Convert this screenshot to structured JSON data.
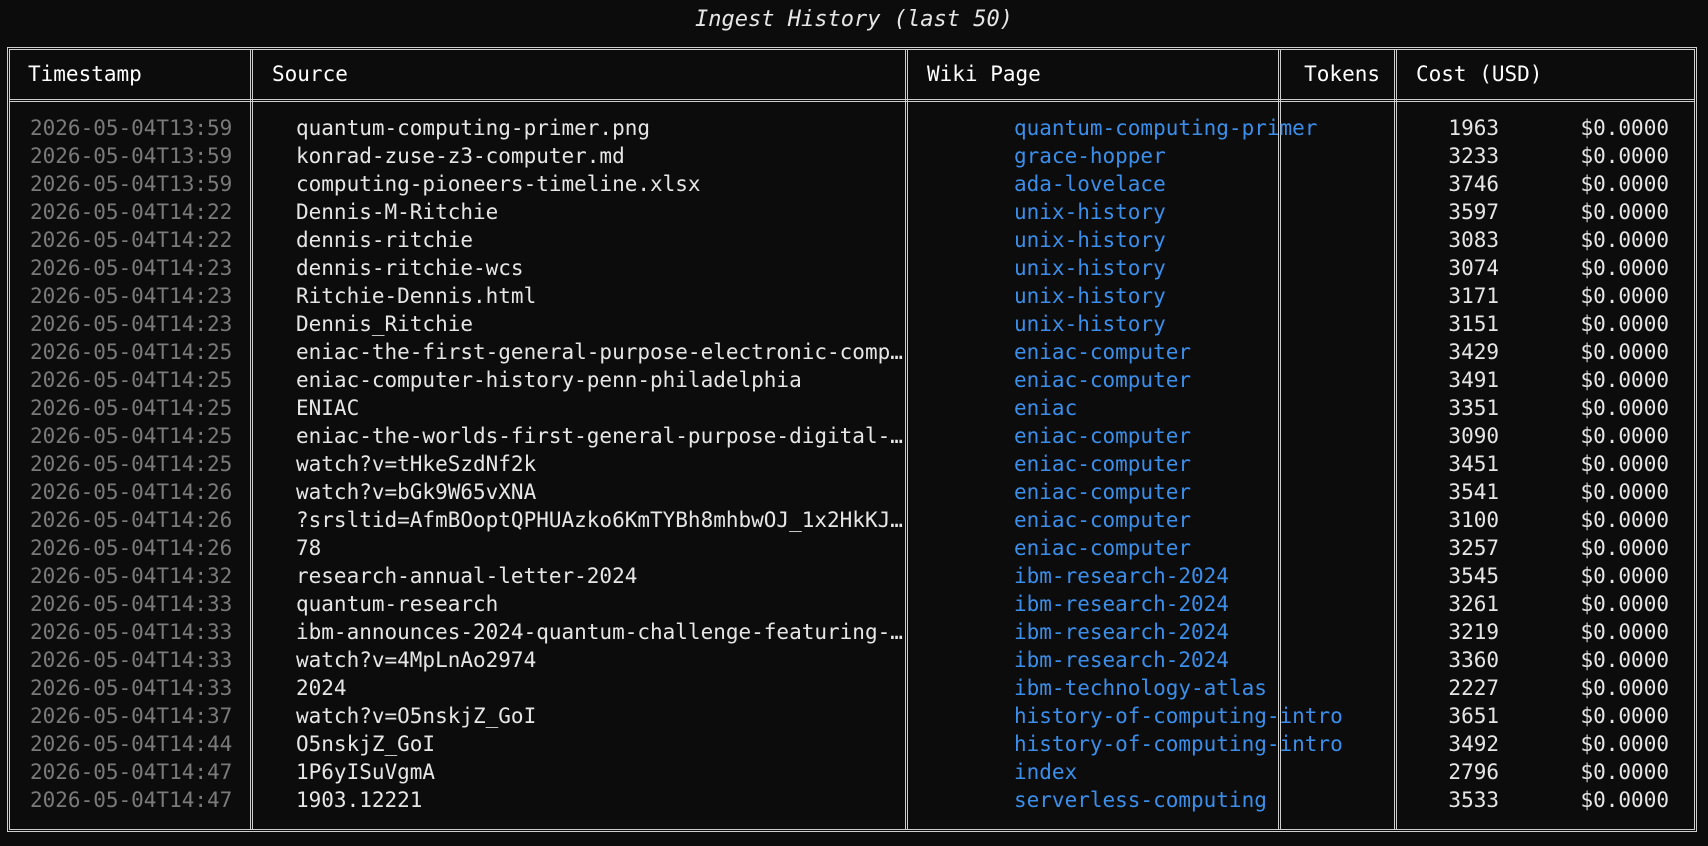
{
  "title": "Ingest History (last 50)",
  "columns": {
    "timestamp": "Timestamp",
    "source": "Source",
    "wiki_page": "Wiki Page",
    "tokens": "Tokens",
    "cost": "Cost (USD)"
  },
  "colors": {
    "background": "#0c0c0c",
    "border": "#cfcfcf",
    "timestamp_text": "#7a7a7a",
    "link_text": "#3b8eea",
    "body_text": "#e6e6e6"
  },
  "rows": [
    {
      "timestamp": "2026-05-04T13:59",
      "source": "quantum-computing-primer.png",
      "wiki_page": "quantum-computing-primer",
      "tokens": "1963",
      "cost": "$0.0000"
    },
    {
      "timestamp": "2026-05-04T13:59",
      "source": "konrad-zuse-z3-computer.md",
      "wiki_page": "grace-hopper",
      "tokens": "3233",
      "cost": "$0.0000"
    },
    {
      "timestamp": "2026-05-04T13:59",
      "source": "computing-pioneers-timeline.xlsx",
      "wiki_page": "ada-lovelace",
      "tokens": "3746",
      "cost": "$0.0000"
    },
    {
      "timestamp": "2026-05-04T14:22",
      "source": "Dennis-M-Ritchie",
      "wiki_page": "unix-history",
      "tokens": "3597",
      "cost": "$0.0000"
    },
    {
      "timestamp": "2026-05-04T14:22",
      "source": "dennis-ritchie",
      "wiki_page": "unix-history",
      "tokens": "3083",
      "cost": "$0.0000"
    },
    {
      "timestamp": "2026-05-04T14:23",
      "source": "dennis-ritchie-wcs",
      "wiki_page": "unix-history",
      "tokens": "3074",
      "cost": "$0.0000"
    },
    {
      "timestamp": "2026-05-04T14:23",
      "source": "Ritchie-Dennis.html",
      "wiki_page": "unix-history",
      "tokens": "3171",
      "cost": "$0.0000"
    },
    {
      "timestamp": "2026-05-04T14:23",
      "source": "Dennis_Ritchie",
      "wiki_page": "unix-history",
      "tokens": "3151",
      "cost": "$0.0000"
    },
    {
      "timestamp": "2026-05-04T14:25",
      "source": "eniac-the-first-general-purpose-electronic-comp…",
      "wiki_page": "eniac-computer",
      "tokens": "3429",
      "cost": "$0.0000"
    },
    {
      "timestamp": "2026-05-04T14:25",
      "source": "eniac-computer-history-penn-philadelphia",
      "wiki_page": "eniac-computer",
      "tokens": "3491",
      "cost": "$0.0000"
    },
    {
      "timestamp": "2026-05-04T14:25",
      "source": "ENIAC",
      "wiki_page": "eniac",
      "tokens": "3351",
      "cost": "$0.0000"
    },
    {
      "timestamp": "2026-05-04T14:25",
      "source": "eniac-the-worlds-first-general-purpose-digital-…",
      "wiki_page": "eniac-computer",
      "tokens": "3090",
      "cost": "$0.0000"
    },
    {
      "timestamp": "2026-05-04T14:25",
      "source": "watch?v=tHkeSzdNf2k",
      "wiki_page": "eniac-computer",
      "tokens": "3451",
      "cost": "$0.0000"
    },
    {
      "timestamp": "2026-05-04T14:26",
      "source": "watch?v=bGk9W65vXNA",
      "wiki_page": "eniac-computer",
      "tokens": "3541",
      "cost": "$0.0000"
    },
    {
      "timestamp": "2026-05-04T14:26",
      "source": "?srsltid=AfmBOoptQPHUAzko6KmTYBh8mhbwOJ_1x2HkKJ…",
      "wiki_page": "eniac-computer",
      "tokens": "3100",
      "cost": "$0.0000"
    },
    {
      "timestamp": "2026-05-04T14:26",
      "source": "78",
      "wiki_page": "eniac-computer",
      "tokens": "3257",
      "cost": "$0.0000"
    },
    {
      "timestamp": "2026-05-04T14:32",
      "source": "research-annual-letter-2024",
      "wiki_page": "ibm-research-2024",
      "tokens": "3545",
      "cost": "$0.0000"
    },
    {
      "timestamp": "2026-05-04T14:33",
      "source": "quantum-research",
      "wiki_page": "ibm-research-2024",
      "tokens": "3261",
      "cost": "$0.0000"
    },
    {
      "timestamp": "2026-05-04T14:33",
      "source": "ibm-announces-2024-quantum-challenge-featuring-…",
      "wiki_page": "ibm-research-2024",
      "tokens": "3219",
      "cost": "$0.0000"
    },
    {
      "timestamp": "2026-05-04T14:33",
      "source": "watch?v=4MpLnAo2974",
      "wiki_page": "ibm-research-2024",
      "tokens": "3360",
      "cost": "$0.0000"
    },
    {
      "timestamp": "2026-05-04T14:33",
      "source": "2024",
      "wiki_page": "ibm-technology-atlas",
      "tokens": "2227",
      "cost": "$0.0000"
    },
    {
      "timestamp": "2026-05-04T14:37",
      "source": "watch?v=O5nskjZ_GoI",
      "wiki_page": "history-of-computing-intro",
      "tokens": "3651",
      "cost": "$0.0000"
    },
    {
      "timestamp": "2026-05-04T14:44",
      "source": "O5nskjZ_GoI",
      "wiki_page": "history-of-computing-intro",
      "tokens": "3492",
      "cost": "$0.0000"
    },
    {
      "timestamp": "2026-05-04T14:47",
      "source": "1P6yISuVgmA",
      "wiki_page": "index",
      "tokens": "2796",
      "cost": "$0.0000"
    },
    {
      "timestamp": "2026-05-04T14:47",
      "source": "1903.12221",
      "wiki_page": "serverless-computing",
      "tokens": "3533",
      "cost": "$0.0000"
    }
  ]
}
